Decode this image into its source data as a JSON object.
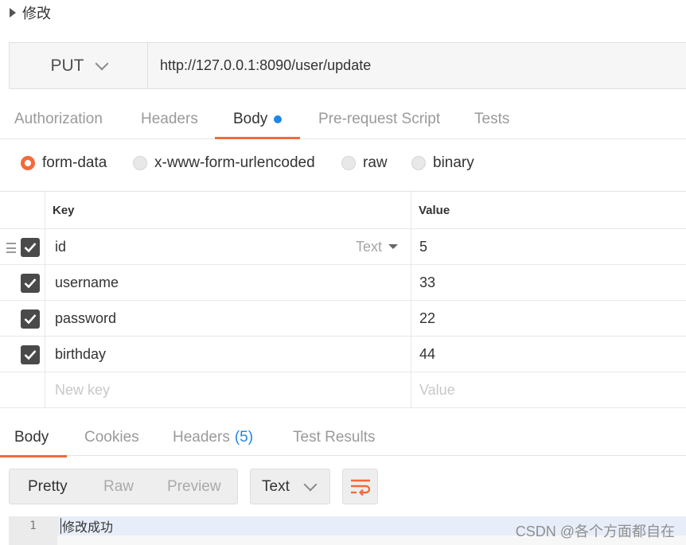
{
  "request": {
    "title": "修改",
    "method": "PUT",
    "url": "http://127.0.0.1:8090/user/update"
  },
  "request_tabs": [
    {
      "label": "Authorization"
    },
    {
      "label": "Headers"
    },
    {
      "label": "Body"
    },
    {
      "label": "Pre-request Script"
    },
    {
      "label": "Tests"
    }
  ],
  "body_types": [
    {
      "label": "form-data",
      "checked": true
    },
    {
      "label": "x-www-form-urlencoded",
      "checked": false
    },
    {
      "label": "raw",
      "checked": false
    },
    {
      "label": "binary",
      "checked": false
    }
  ],
  "kv_table": {
    "headers": {
      "key": "Key",
      "value": "Value"
    },
    "type_select": "Text",
    "rows": [
      {
        "key": "id",
        "value": "5",
        "checked": true
      },
      {
        "key": "username",
        "value": "33",
        "checked": true
      },
      {
        "key": "password",
        "value": "22",
        "checked": true
      },
      {
        "key": "birthday",
        "value": "44",
        "checked": true
      }
    ],
    "new_row": {
      "key_placeholder": "New key",
      "value_placeholder": "Value"
    }
  },
  "response_tabs": [
    {
      "label": "Body"
    },
    {
      "label": "Cookies"
    },
    {
      "label": "Headers",
      "count": "(5)"
    },
    {
      "label": "Test Results"
    }
  ],
  "response_toolbar": {
    "view_modes": [
      "Pretty",
      "Raw",
      "Preview"
    ],
    "format": "Text"
  },
  "response_body": {
    "line_number": "1",
    "text": "修改成功"
  },
  "watermark": "CSDN @各个方面都自在",
  "colors": {
    "accent": "#f26b3a",
    "dot": "#1e88e5",
    "checkbox": "#4a4a4a"
  }
}
